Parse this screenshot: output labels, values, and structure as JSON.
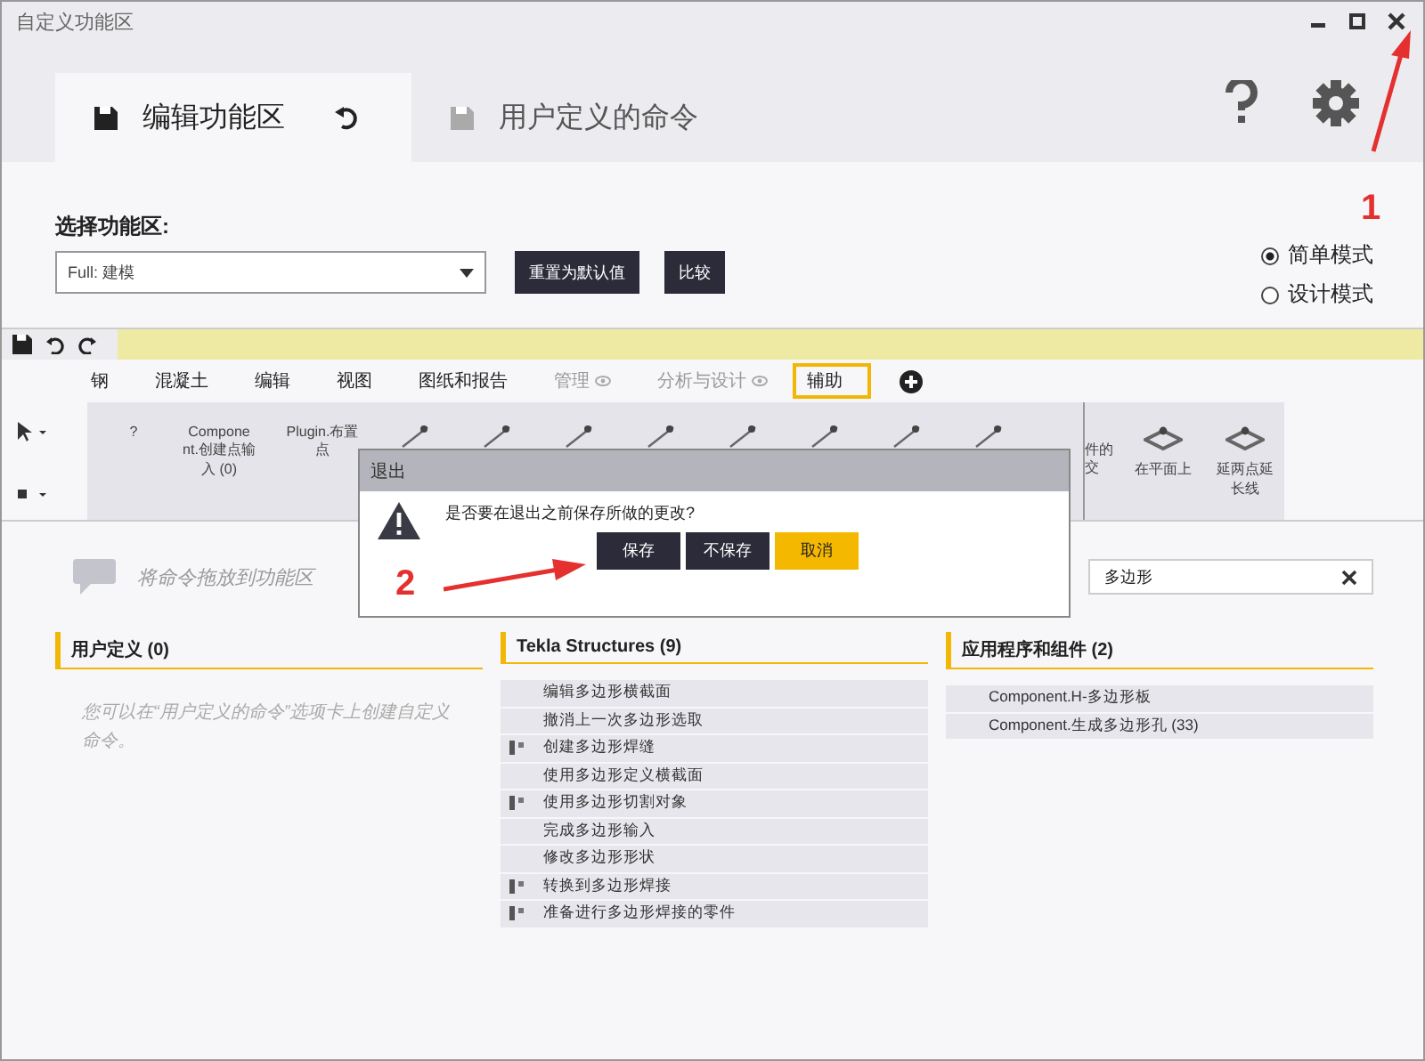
{
  "window": {
    "title": "自定义功能区"
  },
  "tabs": [
    {
      "label": "编辑功能区",
      "selected": true
    },
    {
      "label": "用户定义的命令",
      "selected": false
    }
  ],
  "ribbon_select": {
    "label": "选择功能区:",
    "value": "Full: 建模",
    "buttons": [
      "重置为默认值",
      "比较"
    ]
  },
  "modes": [
    {
      "label": "简单模式",
      "selected": true
    },
    {
      "label": "设计模式",
      "selected": false
    }
  ],
  "ribbon_tabs": [
    {
      "label": "钢",
      "hidden": false,
      "selected": false
    },
    {
      "label": "混凝土",
      "hidden": false,
      "selected": false
    },
    {
      "label": "编辑",
      "hidden": false,
      "selected": false
    },
    {
      "label": "视图",
      "hidden": false,
      "selected": false
    },
    {
      "label": "图纸和报告",
      "hidden": false,
      "selected": false
    },
    {
      "label": "管理",
      "hidden": true,
      "selected": false
    },
    {
      "label": "分析与设计",
      "hidden": true,
      "selected": false
    },
    {
      "label": "辅助",
      "hidden": false,
      "selected": true
    }
  ],
  "ribbon_items": [
    {
      "kind": "label",
      "label": "?"
    },
    {
      "kind": "label",
      "label": "Compone nt.创建点输入 (0)"
    },
    {
      "kind": "label",
      "label": "Plugin.布置点"
    },
    {
      "kind": "icon"
    },
    {
      "kind": "icon"
    },
    {
      "kind": "icon"
    },
    {
      "kind": "icon"
    },
    {
      "kind": "icon"
    },
    {
      "kind": "icon"
    },
    {
      "kind": "icon"
    },
    {
      "kind": "icon"
    },
    {
      "kind": "partial",
      "label": "件的交"
    },
    {
      "kind": "icon_label",
      "label": "在平面上"
    },
    {
      "kind": "icon_label",
      "label": "延两点延长线"
    }
  ],
  "drop_hint": "将命令拖放到功能区",
  "search": {
    "value": "多边形"
  },
  "sections": [
    {
      "title": "用户定义 (0)",
      "note": "您可以在“用户定义的命令”选项卡上创建自定义命令。"
    },
    {
      "title": "Tekla Structures (9)",
      "items": [
        {
          "label": "编辑多边形横截面",
          "has_icon": false
        },
        {
          "label": "撤消上一次多边形选取",
          "has_icon": false
        },
        {
          "label": "创建多边形焊缝",
          "has_icon": true
        },
        {
          "label": "使用多边形定义横截面",
          "has_icon": false
        },
        {
          "label": "使用多边形切割对象",
          "has_icon": true
        },
        {
          "label": "完成多边形输入",
          "has_icon": false
        },
        {
          "label": "修改多边形形状",
          "has_icon": false
        },
        {
          "label": "转换到多边形焊接",
          "has_icon": true
        },
        {
          "label": "准备进行多边形焊接的零件",
          "has_icon": true
        }
      ]
    },
    {
      "title": "应用程序和组件 (2)",
      "items": [
        {
          "label": "Component.H-多边形板",
          "has_icon": false
        },
        {
          "label": "Component.生成多边形孔 (33)",
          "has_icon": false
        }
      ]
    }
  ],
  "dialog": {
    "title": "退出",
    "message": "是否要在退出之前保存所做的更改?",
    "buttons": [
      {
        "label": "保存",
        "kind": "primary"
      },
      {
        "label": "不保存",
        "kind": "primary"
      },
      {
        "label": "取消",
        "kind": "cancel"
      }
    ]
  },
  "annotations": [
    {
      "label": "1"
    },
    {
      "label": "2"
    }
  ]
}
